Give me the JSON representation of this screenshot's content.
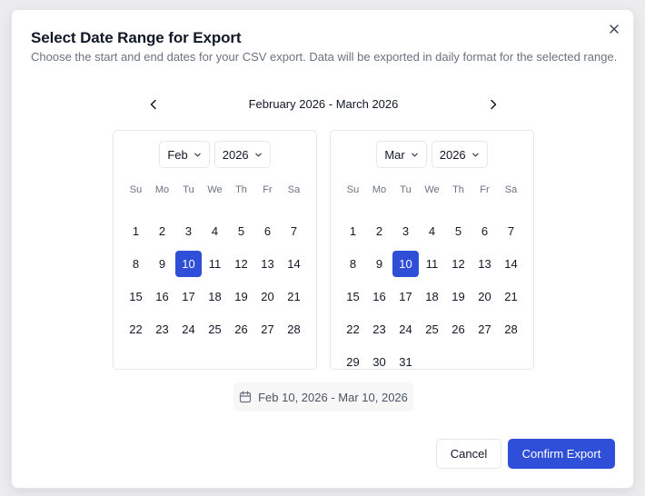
{
  "dialog": {
    "title": "Select Date Range for Export",
    "subtitle": "Choose the start and end dates for your CSV export. Data will be exported in daily format for the selected range.",
    "close_icon": "close-icon"
  },
  "navigation": {
    "prev_icon": "chevron-left-icon",
    "next_icon": "chevron-right-icon",
    "range_label": "February 2026 - March 2026"
  },
  "weekdays": [
    "Su",
    "Mo",
    "Tu",
    "We",
    "Th",
    "Fr",
    "Sa"
  ],
  "calendars": [
    {
      "month_select": "Feb",
      "year_select": "2026",
      "leading_blanks": 0,
      "days_in_month": 28,
      "selected_day": 10
    },
    {
      "month_select": "Mar",
      "year_select": "2026",
      "leading_blanks": 0,
      "days_in_month": 31,
      "selected_day": 10
    }
  ],
  "summary": {
    "icon": "calendar-icon",
    "text": "Feb 10, 2026 - Mar 10, 2026"
  },
  "actions": {
    "cancel_label": "Cancel",
    "confirm_label": "Confirm Export"
  },
  "colors": {
    "accent": "#2f4fd8",
    "muted_text": "#6b7280",
    "border": "#e5e7eb"
  }
}
